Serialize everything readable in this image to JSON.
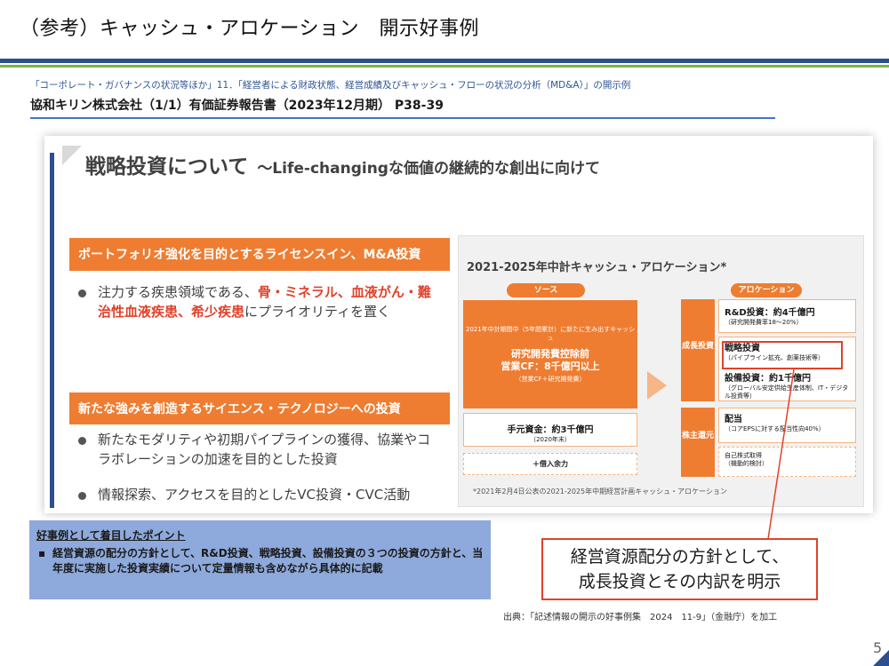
{
  "header": {
    "title": "（参考）キャッシュ・アロケーション　開示好事例"
  },
  "citation": {
    "line": "「コーポレート・ガバナンスの状況等ほか」11．「経営者による財政状態、経営成績及びキャッシュ・フローの状況の分析（MD&A）」の開示例",
    "heading": "協和キリン株式会社（1/1）有価証券報告書（2023年12月期） P38-39"
  },
  "excerpt": {
    "title": "戦略投資について",
    "subtitle": "～Life-changingな価値の継続的な創出に向けて",
    "section1": {
      "heading": "ポートフォリオ強化を目的とするライセンスイン、M&A投資",
      "bullet_pre": "注力する疾患領域である、",
      "bullet_hl": "骨・ミネラル、血液がん・難治性血液疾患、希少疾患",
      "bullet_post": "にプライオリティを置く"
    },
    "section2": {
      "heading": "新たな強みを創造するサイエンス・テクノロジーへの投資",
      "bullet1": "新たなモダリティや初期パイプラインの獲得、協業やコラボレーションの加速を目的とした投資",
      "bullet2": "情報探索、アクセスを目的としたVC投資・CVC活動"
    },
    "allocation": {
      "title": "2021-2025年中計キャッシュ・アロケーション*",
      "source_label": "ソース",
      "alloc_label": "アロケーション",
      "source_small": "2021年中計期間中（5年間累計）に新たに生み出すキャッシュ",
      "source_big1": "研究開発費控除前",
      "source_big2": "営業CF：8千億円以上",
      "source_note": "（営業CF＋研究開発費）",
      "cash_title": "手元資金：約3千億円",
      "cash_sub": "（2020年末）",
      "borrow": "＋借入余力",
      "growth_label": "成長投資",
      "return_label": "株主還元",
      "rd_title": "R&D投資：約4千億円",
      "rd_sub": "（研究開発費率18～20%）",
      "strategic_title": "戦略投資",
      "strategic_sub": "（パイプライン拡充、創薬技術等）",
      "capex_title": "設備投資：約1千億円",
      "capex_sub": "（グローバル安定供給生産体制、IT・デジタル投資等）",
      "dividend_title": "配当",
      "dividend_sub": "（コアEPSに対する配当性向40%）",
      "buyback_title": "自己株式取得",
      "buyback_sub": "（機動的検討）",
      "footnote": "*2021年2月4日公表の2021-2025年中期経営計画キャッシュ・アロケーション"
    }
  },
  "key_point": {
    "title": "好事例として着目したポイント",
    "marker": "▪",
    "text": "経営資源の配分の方針として、R&D投資、戦略投資、設備投資の３つの投資の方針と、当年度に実施した投資実績について定量情報も含めながら具体的に記載"
  },
  "callout": {
    "line1": "経営資源配分の方針として、",
    "line2": "成長投資とその内訳を明示"
  },
  "source": "出典：「記述情報の開示の好事例集　2024　11-9」（金融庁）を加工",
  "page_number": "5",
  "colors": {
    "accent_orange": "#ee7d31",
    "highlight_red": "#e0422b",
    "navy": "#2e4f8f",
    "green": "#7bb342",
    "key_box": "#8eaadc"
  }
}
